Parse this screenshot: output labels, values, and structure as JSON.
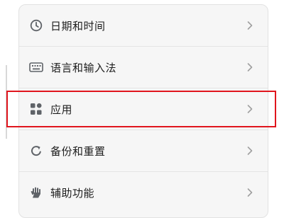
{
  "settings_menu": {
    "items": [
      {
        "label": "日期和时间",
        "icon": "clock-icon"
      },
      {
        "label": "语言和输入法",
        "icon": "keyboard-icon"
      },
      {
        "label": "应用",
        "icon": "apps-grid-icon"
      },
      {
        "label": "备份和重置",
        "icon": "restore-icon"
      },
      {
        "label": "辅助功能",
        "icon": "hand-icon"
      }
    ],
    "chevron_icon": "chevron-right-icon",
    "highlighted_item": "应用"
  },
  "colors": {
    "highlight": "#e0151d",
    "panel_bg": "#f6f6f6",
    "text": "#1e1e1e",
    "icon": "#5f6368",
    "chevron": "#a0a0a0"
  }
}
